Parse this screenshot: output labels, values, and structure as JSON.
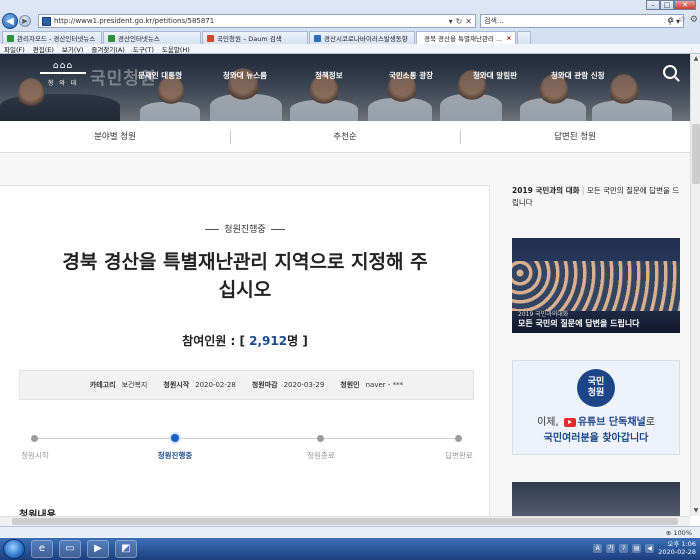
{
  "browser": {
    "url": "http://www1.president.go.kr/petitions/585871",
    "search_placeholder": "검색...",
    "tabs": [
      {
        "label": "관리자모드 - 경산인터넷뉴스",
        "color": "#2f8f3a"
      },
      {
        "label": "경산인터넷뉴스",
        "color": "#2f8f3a"
      },
      {
        "label": "국민청원 – Daum 검색",
        "color": "#d14a2a"
      },
      {
        "label": "경산시코로나바이러스발생동향",
        "color": "#2a6fbf"
      },
      {
        "label": "경북 경산을 특별재난관리 ...",
        "color": "#1d4486",
        "active": true
      }
    ],
    "menu": [
      "파일(F)",
      "편집(E)",
      "보기(V)",
      "즐겨찾기(A)",
      "도구(T)",
      "도움말(H)"
    ],
    "zoom": "100%"
  },
  "site": {
    "logo_label": "청 와 대",
    "hero_title": "국민청원",
    "nav": [
      "문재인 대통령",
      "청와대 뉴스룸",
      "정책정보",
      "국민소통 광장",
      "청와대 알림판",
      "청와대 관람 신청"
    ],
    "subnav": [
      "분야별 청원",
      "추천순",
      "답변된 청원"
    ]
  },
  "petition": {
    "status": "청원진행중",
    "title_line1": "경북 경산을 특별재난관리 지역으로 지정해 주",
    "title_line2": "십시오",
    "count_label": "참여인원 : [ ",
    "count_value": "2,912",
    "count_unit": "명",
    "count_close": " ]",
    "category_label": "카테고리",
    "category": "보건복지",
    "start_label": "청원시작",
    "start_date": "2020-02-28",
    "end_label": "청원마감",
    "end_date": "2020-03-29",
    "author_label": "청원인",
    "author": "naver - ***",
    "steps": [
      "청원시작",
      "청원진행중",
      "청원종료",
      "답변완료"
    ],
    "content_heading": "청원내용"
  },
  "sidebar": {
    "caption_bold": "2019 국민과의 대화",
    "caption_rest": "모든 국민의 질문에 답변을 드립니다",
    "photo_small": "2019 국민과의대화",
    "photo_big": "모든 국민의 질문에 답변을 드립니다",
    "banner_circle_1": "국민",
    "banner_circle_2": "청원",
    "banner_line1_a": "이제,",
    "banner_line1_b": "유튜브 단독채널",
    "banner_line1_c": "로",
    "banner_line2": "국민여러분을 찾아갑니다"
  },
  "taskbar": {
    "time": "오후 1:06",
    "date": "2020-02-28"
  }
}
